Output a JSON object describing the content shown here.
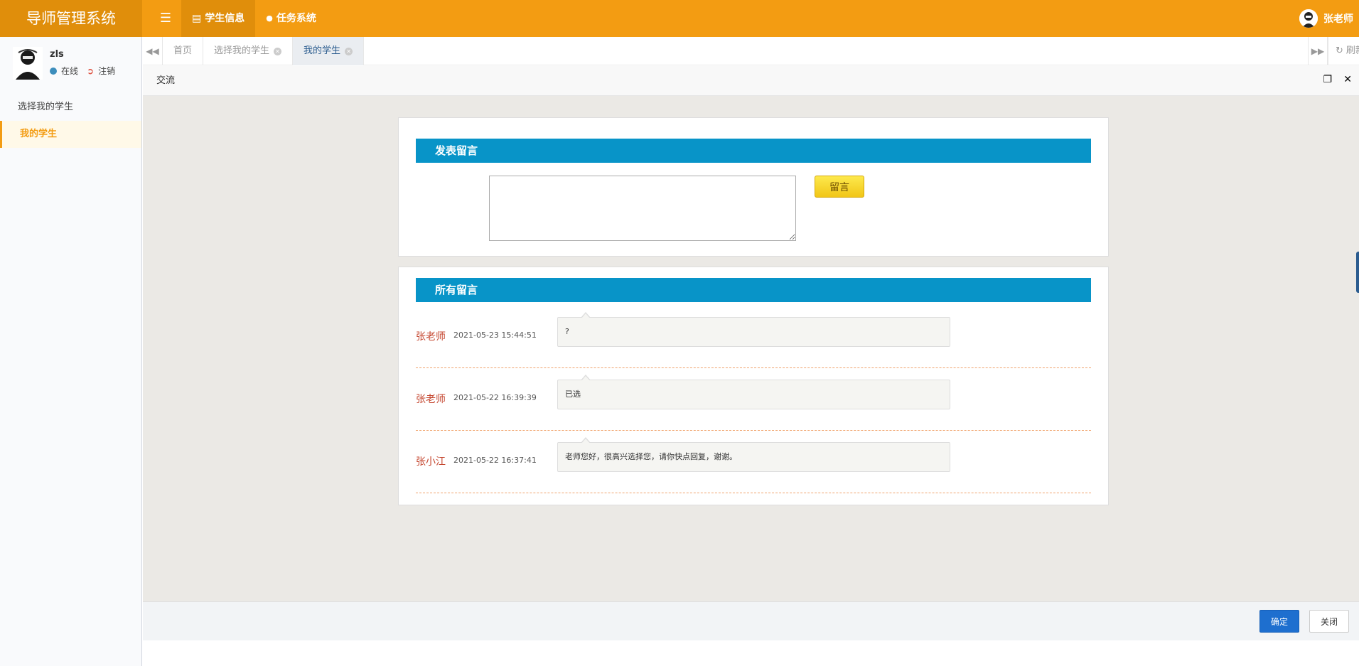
{
  "header": {
    "logo": "导师管理系统",
    "nav": [
      {
        "label": "学生信息"
      },
      {
        "label": "任务系统"
      }
    ],
    "user": "张老师"
  },
  "sidebar": {
    "username": "zls",
    "status": "在线",
    "logout": "注销",
    "items": [
      {
        "label": "选择我的学生"
      },
      {
        "label": "我的学生"
      }
    ]
  },
  "tabs": {
    "items": [
      {
        "label": "首页"
      },
      {
        "label": "选择我的学生"
      },
      {
        "label": "我的学生"
      }
    ],
    "refresh": "刷新"
  },
  "dialog": {
    "title": "交流",
    "post_section_title": "发表留言",
    "textarea_value": "",
    "post_button": "留言",
    "list_section_title": "所有留言",
    "messages": [
      {
        "author": "张老师",
        "time": "2021-05-23 15:44:51",
        "content": "?"
      },
      {
        "author": "张老师",
        "time": "2021-05-22 16:39:39",
        "content": "已选"
      },
      {
        "author": "张小江",
        "time": "2021-05-22 16:37:41",
        "content": "老师您好，很高兴选择您，请你快点回复，谢谢。"
      }
    ],
    "ok_button": "确定",
    "close_button": "关闭"
  },
  "colors": {
    "header": "#f39c12",
    "header_dark": "#e08e0b",
    "section_head": "#0894c8",
    "author": "#c4452e",
    "primary_button": "#1e6fcf"
  }
}
